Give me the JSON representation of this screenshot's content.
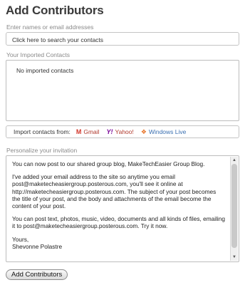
{
  "page_title": "Add Contributors",
  "search": {
    "label": "Enter names or email addresses",
    "placeholder": "Click here to search your contacts"
  },
  "imported": {
    "label": "Your Imported Contacts",
    "empty_text": "No imported contacts"
  },
  "import_bar": {
    "label": "Import contacts from:",
    "providers": [
      {
        "name": "Gmail",
        "icon": "gmail-icon"
      },
      {
        "name": "Yahoo!",
        "icon": "yahoo-icon"
      },
      {
        "name": "Windows Live",
        "icon": "windows-live-icon"
      }
    ]
  },
  "invitation": {
    "label": "Personalize your invitation",
    "paragraphs": [
      "You can now post to our shared group blog, MakeTechEasier Group Blog.",
      "I've added your email address to the site so anytime you email post@maketecheasiergroup.posterous.com, you'll see it online at http://maketecheasiergroup.posterous.com. The subject of your post becomes the title of your post, and the body and attachments of the email become the content of your post.",
      "You can post text, photos, music, video, documents and all kinds of files, emailing it to post@maketecheasiergroup.posterous.com. Try it now.",
      "Yours,",
      "Shevonne Polastre"
    ]
  },
  "submit_label": "Add Contributors"
}
